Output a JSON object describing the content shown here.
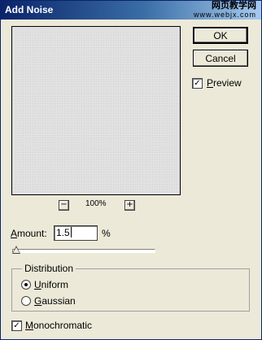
{
  "window": {
    "title": "Add Noise",
    "watermark_line1": "网页教学网",
    "watermark_line2": "www.webjx.com"
  },
  "buttons": {
    "ok": "OK",
    "cancel": "Cancel"
  },
  "preview_option": {
    "label": "Preview",
    "checked": true,
    "check_glyph": "✓"
  },
  "zoom": {
    "minus": "−",
    "plus": "+",
    "level": "100%"
  },
  "amount": {
    "label": "Amount:",
    "value": "1.5",
    "unit": "%",
    "slider_fraction": 0.0
  },
  "distribution": {
    "title": "Distribution",
    "options": [
      {
        "label": "Uniform",
        "selected": true
      },
      {
        "label": "Gaussian",
        "selected": false
      }
    ]
  },
  "monochromatic": {
    "label": "Monochromatic",
    "checked": true,
    "check_glyph": "✓"
  },
  "colors": {
    "dialog_bg": "#ece9d8",
    "title_start": "#0a246a",
    "title_end": "#a6caf0"
  }
}
